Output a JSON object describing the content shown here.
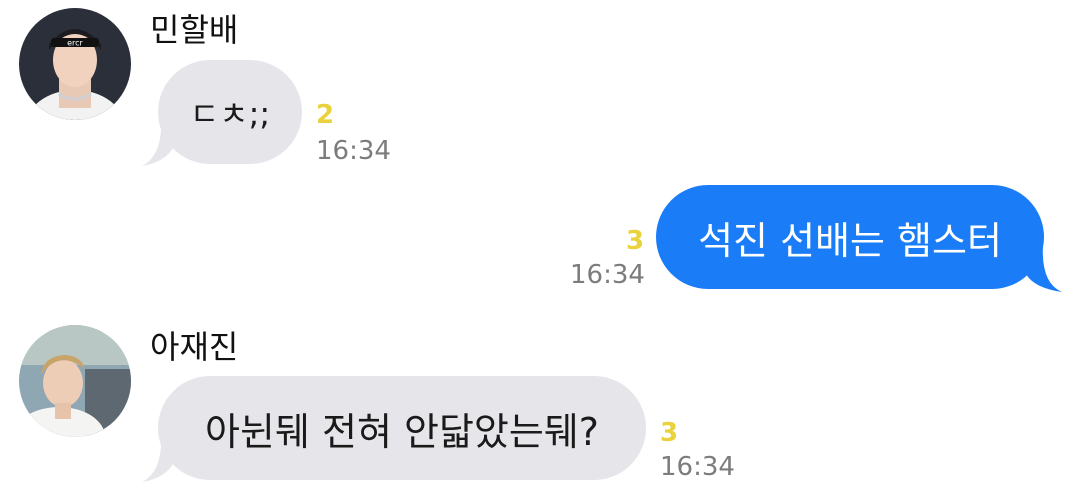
{
  "messages": [
    {
      "sender": "민할배",
      "text": "ㄷㅊ;;",
      "unread": "2",
      "time": "16:34",
      "direction": "incoming",
      "avatar_icon": "profile-photo-icon"
    },
    {
      "text": "석진 선배는 햄스터",
      "unread": "3",
      "time": "16:34",
      "direction": "outgoing"
    },
    {
      "sender": "아재진",
      "text": "아뉜뒈 전혀 안닯았는뒈?",
      "unread": "3",
      "time": "16:34",
      "direction": "incoming",
      "avatar_icon": "profile-photo-icon"
    }
  ],
  "colors": {
    "incoming_bubble": "#e6e5ea",
    "outgoing_bubble": "#1a7cf6",
    "unread_count": "#e9d23c",
    "timestamp": "#7c7c7c"
  }
}
